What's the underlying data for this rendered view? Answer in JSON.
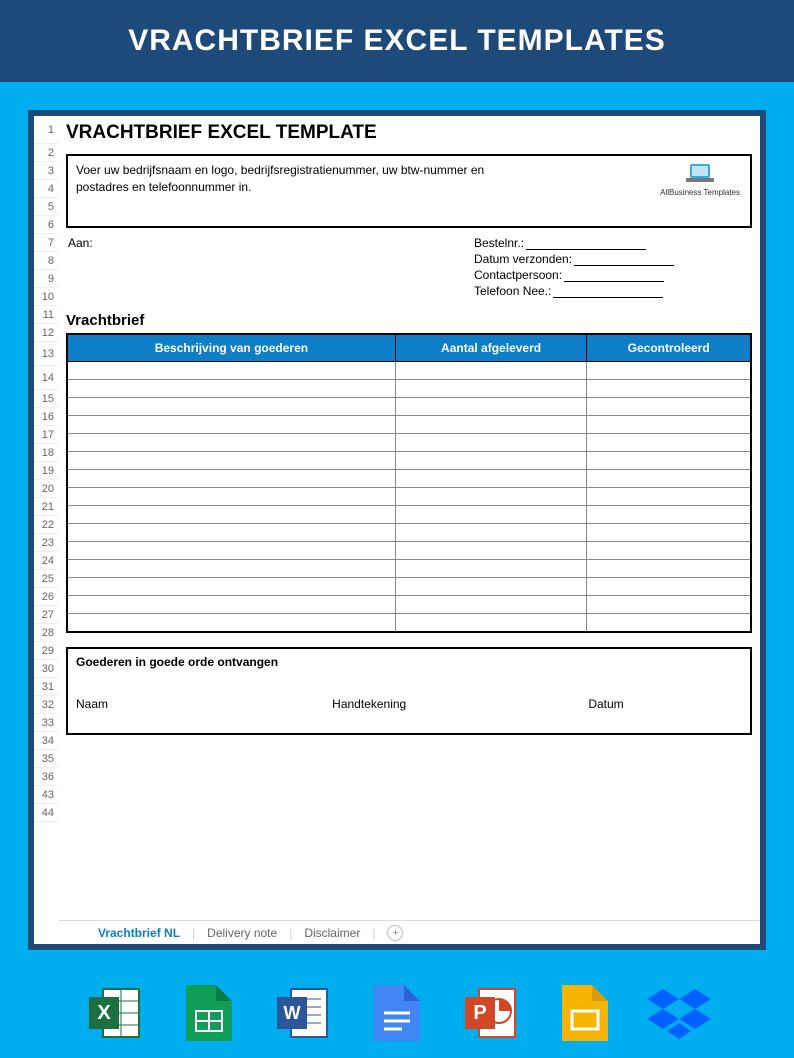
{
  "banner": "VRACHTBRIEF EXCEL TEMPLATES",
  "sheet": {
    "title": "VRACHTBRIEF EXCEL TEMPLATE",
    "introText": "Voer uw bedrijfsnaam en logo, bedrijfsregistratienummer, uw btw-nummer en postadres en telefoonnummer in.",
    "logoText": "AllBusiness Templates",
    "toLabel": "Aan:",
    "orderLabel": "Bestelnr.:",
    "dateLabel": "Datum verzonden:",
    "contactLabel": "Contactpersoon:",
    "phoneLabel": "Telefoon Nee.:",
    "sectionTitle": "Vrachtbrief",
    "col1": "Beschrijving van goederen",
    "col2": "Aantal afgeleverd",
    "col3": "Gecontroleerd",
    "receivedTitle": "Goederen in goede orde ontvangen",
    "sigName": "Naam",
    "sigSign": "Handtekening",
    "sigDate": "Datum"
  },
  "rowNumbers": [
    "1",
    "2",
    "3",
    "4",
    "5",
    "6",
    "7",
    "8",
    "9",
    "10",
    "11",
    "12",
    "13",
    "14",
    "15",
    "16",
    "17",
    "18",
    "19",
    "20",
    "21",
    "22",
    "23",
    "24",
    "25",
    "26",
    "27",
    "28",
    "29",
    "30",
    "31",
    "32",
    "33",
    "34",
    "35",
    "36",
    "43",
    "44"
  ],
  "tabs": {
    "active": "Vrachtbrief NL",
    "t2": "Delivery note",
    "t3": "Disclaimer"
  },
  "apps": [
    "excel",
    "sheets",
    "word",
    "docs",
    "powerpoint",
    "slides",
    "dropbox"
  ]
}
